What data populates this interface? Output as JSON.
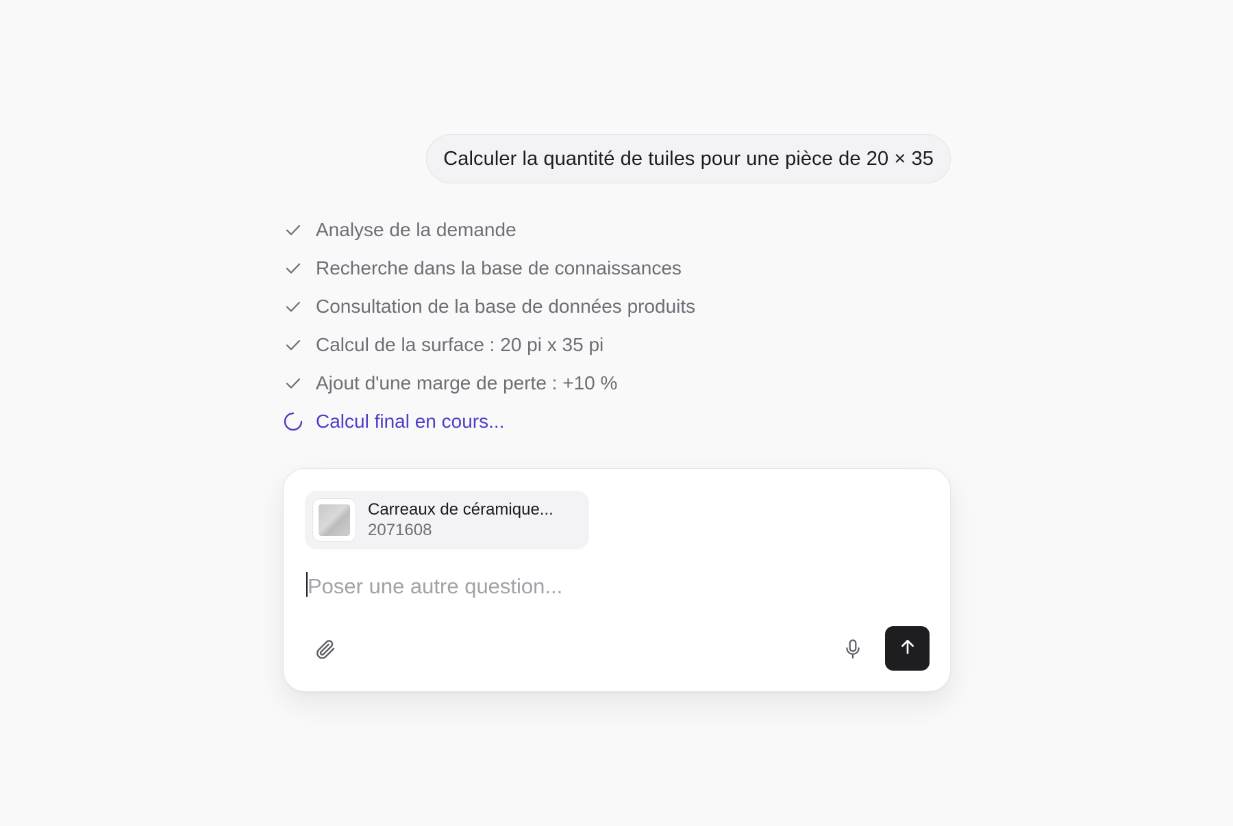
{
  "user_message": {
    "text": "Calculer la quantité de tuiles pour une pièce de 20 × 35"
  },
  "steps": [
    {
      "label": "Analyse de la demande",
      "status": "done",
      "icon": "check-icon"
    },
    {
      "label": "Recherche dans la base de connaissances",
      "status": "done",
      "icon": "check-icon"
    },
    {
      "label": "Consultation de la base de données produits",
      "status": "done",
      "icon": "check-icon"
    },
    {
      "label": "Calcul de la surface : 20 pi x 35 pi",
      "status": "done",
      "icon": "check-icon"
    },
    {
      "label": "Ajout d'une marge de perte : +10 %",
      "status": "done",
      "icon": "check-icon"
    },
    {
      "label": "Calcul final en cours...",
      "status": "in-progress",
      "icon": "spinner-icon"
    }
  ],
  "composer": {
    "attachment": {
      "title": "Carreaux de céramique...",
      "sku": "2071608",
      "icon": "product-thumbnail"
    },
    "placeholder": "Poser une autre question...",
    "value": "",
    "attach_icon": "paperclip-icon",
    "mic_icon": "microphone-icon",
    "send_icon": "arrow-up-icon"
  },
  "colors": {
    "background": "#f9f9fa",
    "step_text": "#6e6e76",
    "active_step": "#4b3fc7",
    "send_button": "#1e1e20"
  }
}
